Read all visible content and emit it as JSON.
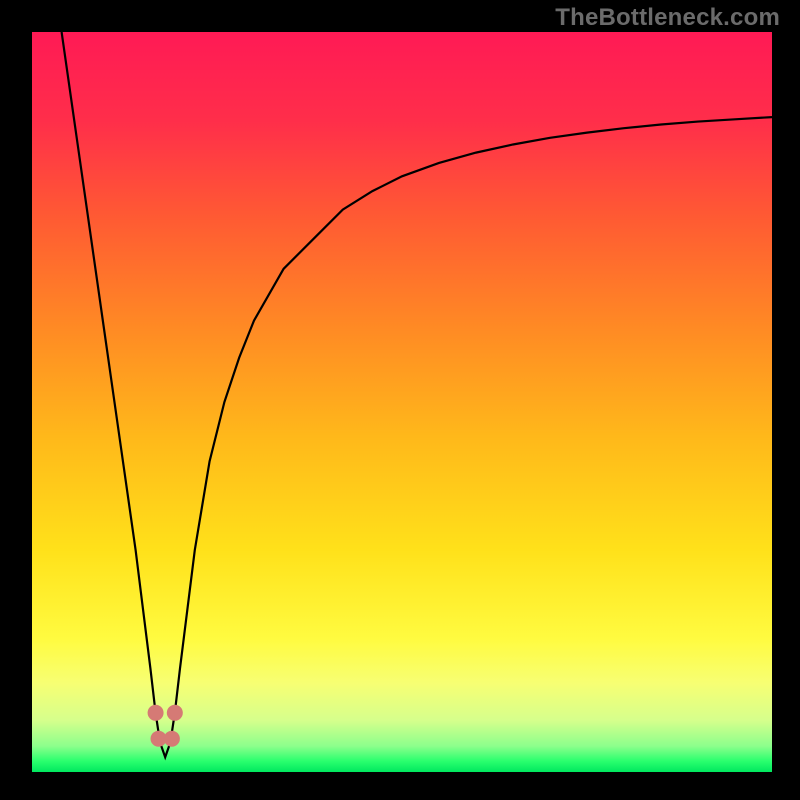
{
  "watermark": "TheBottleneck.com",
  "colors": {
    "curve": "#000000",
    "marker": "#d57a75",
    "frame": "#000000"
  },
  "gradient_stops": [
    {
      "offset": 0.0,
      "color": "#ff1a55"
    },
    {
      "offset": 0.12,
      "color": "#ff2e4a"
    },
    {
      "offset": 0.25,
      "color": "#ff5a33"
    },
    {
      "offset": 0.4,
      "color": "#ff8a24"
    },
    {
      "offset": 0.55,
      "color": "#ffb91a"
    },
    {
      "offset": 0.7,
      "color": "#ffe11a"
    },
    {
      "offset": 0.82,
      "color": "#fffb40"
    },
    {
      "offset": 0.88,
      "color": "#f7ff73"
    },
    {
      "offset": 0.93,
      "color": "#d6ff8c"
    },
    {
      "offset": 0.965,
      "color": "#8cff8c"
    },
    {
      "offset": 0.985,
      "color": "#2bff6e"
    },
    {
      "offset": 1.0,
      "color": "#00e85f"
    }
  ],
  "chart_data": {
    "type": "line",
    "title": "",
    "xlabel": "",
    "ylabel": "",
    "xlim": [
      0,
      100
    ],
    "ylim": [
      0,
      100
    ],
    "x": [
      4,
      6,
      8,
      10,
      12,
      14,
      15,
      16,
      16.7,
      17.3,
      18,
      18.7,
      19.3,
      20,
      21,
      22,
      24,
      26,
      28,
      30,
      34,
      38,
      42,
      46,
      50,
      55,
      60,
      65,
      70,
      75,
      80,
      85,
      90,
      95,
      100
    ],
    "y": [
      100,
      86,
      72,
      58,
      44,
      30,
      22,
      14,
      8,
      4,
      2,
      4,
      8,
      14,
      22,
      30,
      42,
      50,
      56,
      61,
      68,
      72,
      76,
      78.5,
      80.5,
      82.3,
      83.7,
      84.8,
      85.7,
      86.4,
      87,
      87.5,
      87.9,
      88.2,
      88.5
    ],
    "markers": [
      {
        "x": 16.7,
        "y": 8.0
      },
      {
        "x": 17.1,
        "y": 4.5
      },
      {
        "x": 18.9,
        "y": 4.5
      },
      {
        "x": 19.3,
        "y": 8.0
      }
    ],
    "marker_radius_px": 8
  }
}
